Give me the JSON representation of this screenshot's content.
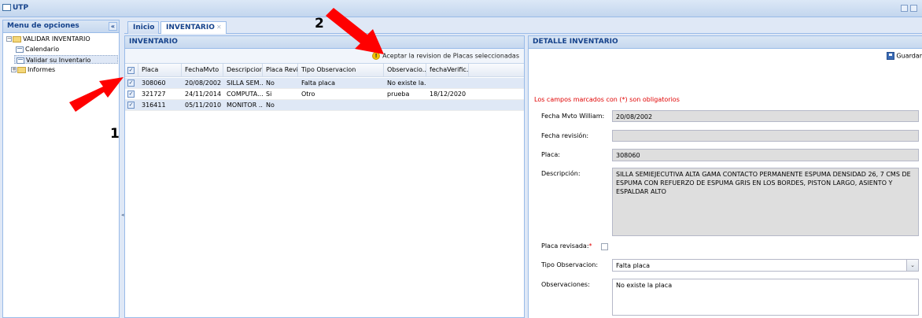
{
  "app": {
    "title": "UTP",
    "window_icon": "window-icon"
  },
  "sidebar": {
    "title": "Menu de opciones",
    "collapse_glyph": "«",
    "tree": [
      {
        "label": "VALIDAR INVENTARIO",
        "icon": "folder-icon",
        "expanded": true
      },
      {
        "label": "Calendario",
        "icon": "page-icon"
      },
      {
        "label": "Validar su Inventario",
        "icon": "page-icon",
        "selected": true
      },
      {
        "label": "Informes",
        "icon": "folder-icon",
        "expanded": false
      }
    ]
  },
  "tabs": [
    {
      "label": "Inicio",
      "active": false
    },
    {
      "label": "INVENTARIO",
      "active": true,
      "closable": true
    }
  ],
  "inventory": {
    "title": "INVENTARIO",
    "toolbar_accept": "Aceptar la revision de Placas seleccionadas",
    "columns": [
      "Placa",
      "FechaMvto",
      "Descripcion",
      "Placa Revis...",
      "Tipo Observacion",
      "Observacio...",
      "fechaVerific..."
    ],
    "rows": [
      {
        "checked": true,
        "cells": [
          "308060",
          "20/08/2002",
          "SILLA SEM...",
          "No",
          "Falta placa",
          "No existe la...",
          ""
        ]
      },
      {
        "checked": true,
        "cells": [
          "321727",
          "24/11/2014",
          "COMPUTA...",
          "Si",
          "Otro",
          "prueba",
          "18/12/2020"
        ]
      },
      {
        "checked": true,
        "cells": [
          "316411",
          "05/11/2010",
          "MONITOR ...",
          "No",
          "",
          "",
          ""
        ]
      }
    ]
  },
  "detail": {
    "title": "DETALLE INVENTARIO",
    "save_label": "Guardar",
    "required_note": "Los campos marcados con (*) son obligatorios",
    "fecha_mvto_label": "Fecha Mvto William:",
    "fecha_mvto_value": "20/08/2002",
    "fecha_revision_label": "Fecha revisión:",
    "fecha_revision_value": "",
    "placa_label": "Placa:",
    "placa_value": "308060",
    "descripcion_label": "Descripción:",
    "descripcion_value": "SILLA SEMIEJECUTIVA ALTA GAMA CONTACTO PERMANENTE ESPUMA DENSIDAD 26, 7 CMS DE ESPUMA CON REFUERZO DE ESPUMA GRIS EN LOS BORDES, PISTON LARGO, ASIENTO Y ESPALDAR ALTO",
    "placa_revisada_label": "Placa revisada:",
    "placa_revisada_required": "*",
    "placa_revisada_checked": false,
    "tipo_obs_label": "Tipo Observacion:",
    "tipo_obs_value": "Falta placa",
    "observaciones_label": "Observaciones:",
    "observaciones_value": "No existe la placa"
  },
  "annotations": {
    "label_1": "1",
    "label_2": "2",
    "arrow_color": "#ff0000"
  }
}
